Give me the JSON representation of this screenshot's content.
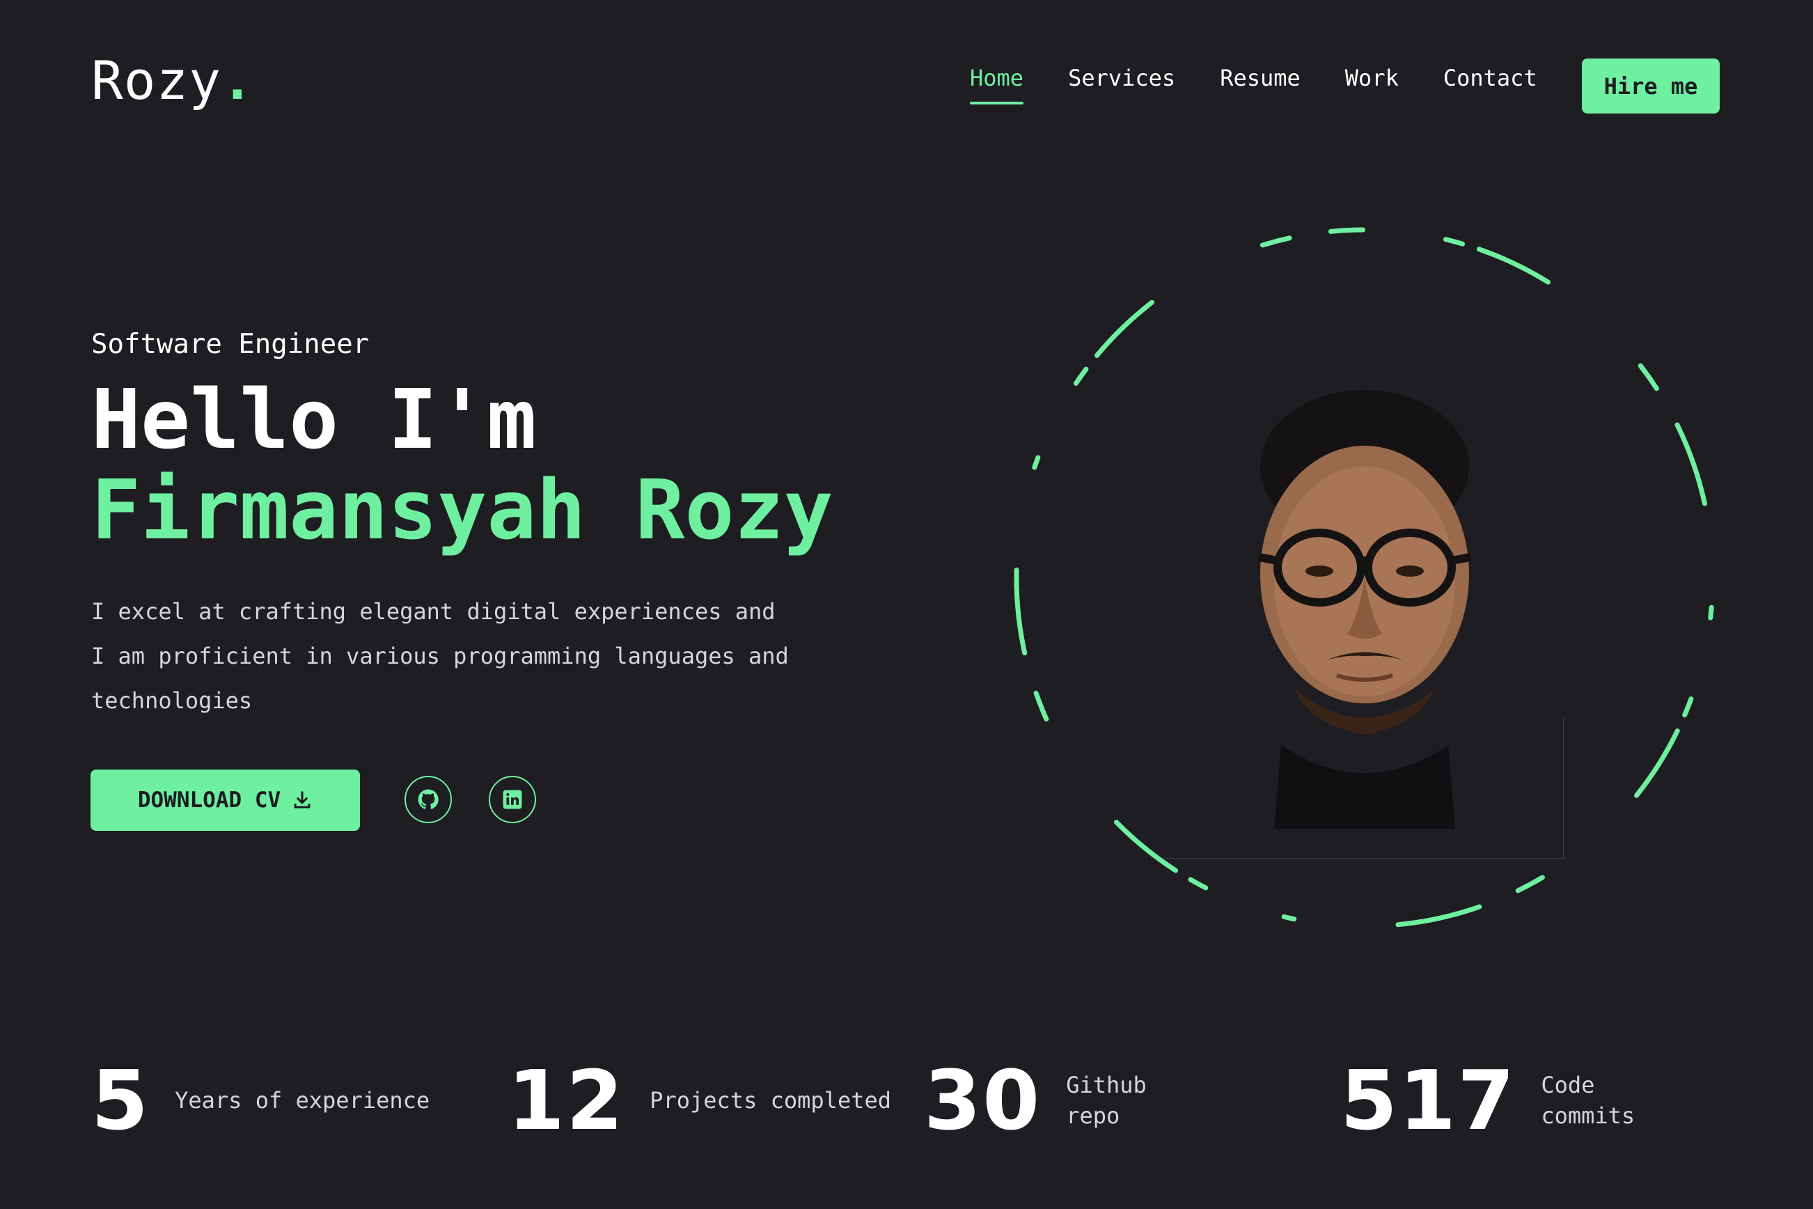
{
  "header": {
    "logo_text": "Rozy",
    "logo_dot": ".",
    "nav": [
      {
        "label": "Home",
        "active": true
      },
      {
        "label": "Services",
        "active": false
      },
      {
        "label": "Resume",
        "active": false
      },
      {
        "label": "Work",
        "active": false
      },
      {
        "label": "Contact",
        "active": false
      }
    ],
    "hire_label": "Hire me"
  },
  "hero": {
    "role": "Software Engineer",
    "greeting": "Hello I'm",
    "name": "Firmansyah Rozy",
    "description_lines": [
      "I excel at crafting elegant digital experiences and",
      "I am proficient in various programming languages and",
      "technologies"
    ],
    "download_label": "DOWNLOAD CV",
    "download_icon": "download-icon",
    "socials": [
      {
        "name": "github",
        "icon": "github-icon"
      },
      {
        "name": "linkedin",
        "icon": "linkedin-icon"
      }
    ]
  },
  "stats": [
    {
      "value": "5",
      "label_lines": [
        "Years of experience"
      ]
    },
    {
      "value": "12",
      "label_lines": [
        "Projects completed"
      ]
    },
    {
      "value": "30",
      "label_lines": [
        "Github",
        "repo"
      ]
    },
    {
      "value": "517",
      "label_lines": [
        "Code",
        "commits"
      ]
    }
  ],
  "colors": {
    "background": "#1d1d22",
    "accent": "#6ff0a0",
    "text": "#ffffff",
    "muted_text": "#d6d6da"
  }
}
